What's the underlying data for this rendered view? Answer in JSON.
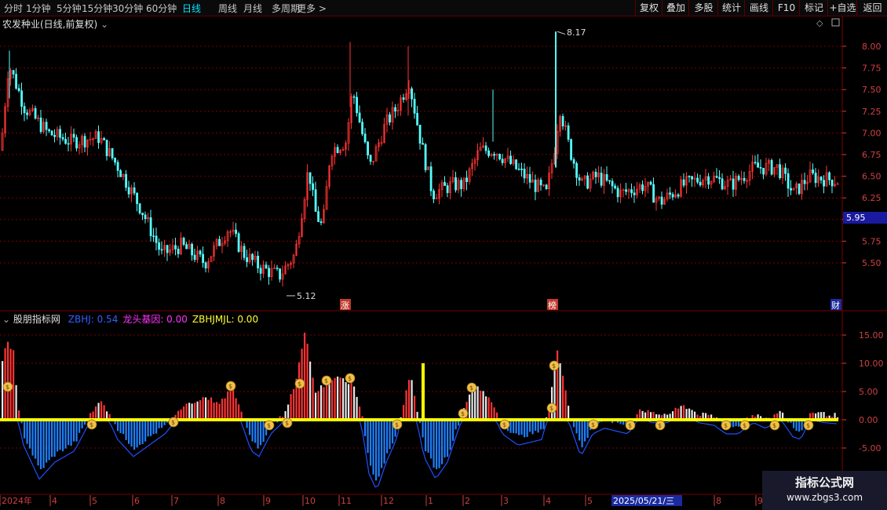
{
  "toolbar": {
    "periods": [
      "分时",
      "1分钟",
      "5分钟",
      "15分钟",
      "30分钟",
      "60分钟",
      "日线",
      "周线",
      "月线",
      "多周期",
      "更多 >"
    ],
    "active_period": "日线",
    "right_buttons": [
      "复权",
      "叠加",
      "多股",
      "统计",
      "画线",
      "F10",
      "标记",
      "+自选",
      "返回"
    ]
  },
  "stock_title": "农发种业(日线,前复权)",
  "indicator_title": "股朋指标网",
  "indicator_values": [
    {
      "label": "ZBHJ: 0.54",
      "color": "#3060ff"
    },
    {
      "label": "龙头基因: 0.00",
      "color": "#ff33ff"
    },
    {
      "label": "ZBHJMJL: 0.00",
      "color": "#ffff33"
    }
  ],
  "price_axis": [
    "8.00",
    "7.75",
    "7.50",
    "7.25",
    "7.00",
    "6.75",
    "6.50",
    "6.25",
    "6.00",
    "5.75",
    "5.50"
  ],
  "current_price": "5.95",
  "high_label": "8.17",
  "low_label": "5.12",
  "markers": {
    "zhang": "涨",
    "bang": "榜",
    "cai": "财"
  },
  "indicator_axis": [
    "15.00",
    "10.00",
    "5.00",
    "0.00",
    "-5.00"
  ],
  "x_axis": [
    "2024年",
    "4",
    "5",
    "6",
    "7",
    "8",
    "9",
    "10",
    "11",
    "12",
    "1",
    "2",
    "3",
    "4",
    "5",
    "2025/05/21/三",
    "8",
    "9"
  ],
  "watermark": {
    "line1": "指标公式网",
    "line2": "www.zbgs3.com"
  },
  "colors": {
    "up": "#ff3333",
    "down": "#54ffff",
    "grid": "#7a0000",
    "zero_line": "#ffff00",
    "neg_bar": "#1f7fff"
  },
  "chart_data": {
    "type": "candlestick",
    "symbol": "农发种业",
    "ylim": [
      5.12,
      8.17
    ],
    "high": 8.17,
    "low": 5.12,
    "last": 5.95,
    "indicator": {
      "name": "股朋指标网",
      "ylim": [
        -5,
        15
      ]
    }
  }
}
